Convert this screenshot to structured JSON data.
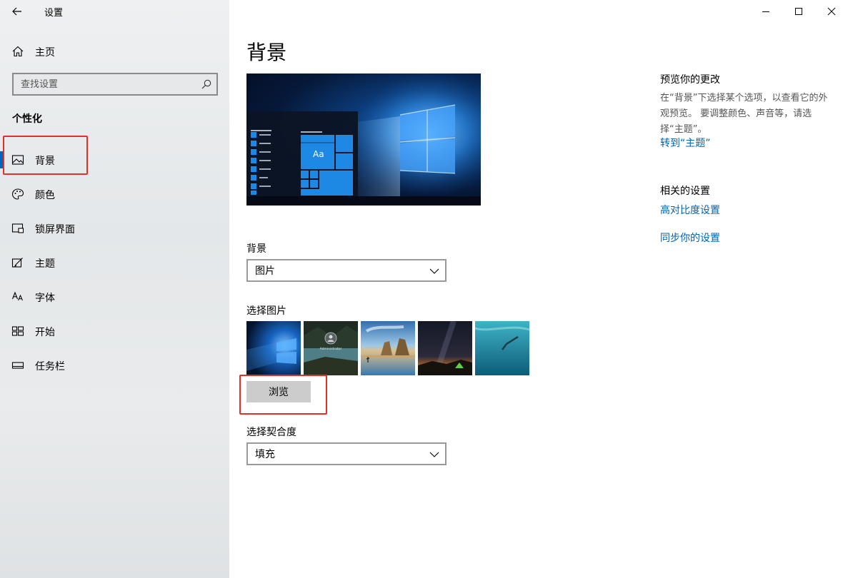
{
  "window": {
    "title": "设置"
  },
  "sidebar": {
    "home_label": "主页",
    "search_placeholder": "查找设置",
    "section_title": "个性化",
    "items": [
      {
        "label": "背景",
        "icon": "picture-icon",
        "active": true
      },
      {
        "label": "颜色",
        "icon": "palette-icon"
      },
      {
        "label": "锁屏界面",
        "icon": "lock-screen-icon"
      },
      {
        "label": "主题",
        "icon": "theme-brush-icon"
      },
      {
        "label": "字体",
        "icon": "font-icon"
      },
      {
        "label": "开始",
        "icon": "start-grid-icon"
      },
      {
        "label": "任务栏",
        "icon": "taskbar-icon"
      }
    ]
  },
  "main": {
    "page_title": "背景",
    "preview_sample_text": "Aa",
    "background_label": "背景",
    "background_value": "图片",
    "choose_picture_label": "选择图片",
    "browse_label": "浏览",
    "fit_label": "选择契合度",
    "fit_value": "填充",
    "thumbnail_caption": "Administrator"
  },
  "aside": {
    "preview_title": "预览你的更改",
    "preview_text": "在“背景”下选择某个选项，以查看它的外观预览。 要调整颜色、声音等，请选择“主题”。",
    "go_theme_link": "转到“主题”",
    "related_title": "相关的设置",
    "high_contrast_link": "高对比度设置",
    "sync_link": "同步你的设置"
  },
  "colors": {
    "accent": "#0078d7",
    "link": "#0063b1",
    "highlight": "#e0302a"
  }
}
